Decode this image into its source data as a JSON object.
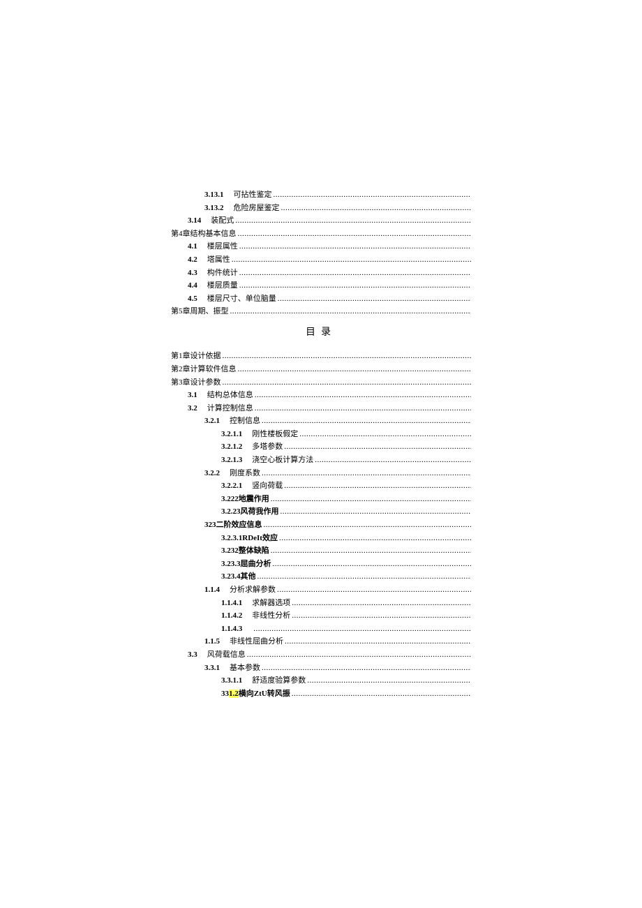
{
  "tocTitle": "目录",
  "block1": [
    {
      "indent": 2,
      "num": "3.13.1",
      "label": "可拈性鉴定"
    },
    {
      "indent": 2,
      "num": "3.13.2",
      "label": "危险房屋鉴定"
    },
    {
      "indent": 1,
      "num": "3.14",
      "label": "装配式"
    },
    {
      "indent": 0,
      "num": "",
      "label": "第4章结构基本信息",
      "plain": true
    },
    {
      "indent": 1,
      "num": "4.1",
      "label": "楼层属性"
    },
    {
      "indent": 1,
      "num": "4.2",
      "label": "塔属性"
    },
    {
      "indent": 1,
      "num": "4.3",
      "label": "构件统计"
    },
    {
      "indent": 1,
      "num": "4.4",
      "label": "楼层质量"
    },
    {
      "indent": 1,
      "num": "4.5",
      "label": "楼层尺寸、单位脑量"
    },
    {
      "indent": 0,
      "num": "",
      "label": "第5章周期、振型",
      "plain": true
    }
  ],
  "block2": [
    {
      "indent": 0,
      "num": "",
      "label": "第1章设计依据",
      "plain": true
    },
    {
      "indent": 0,
      "num": "",
      "label": "第2章计算软件信息",
      "plain": true
    },
    {
      "indent": 0,
      "num": "",
      "label": "第3章设计参数",
      "plain": true
    },
    {
      "indent": 1,
      "num": "3.1",
      "label": "结构总体信息"
    },
    {
      "indent": 1,
      "num": "3.2",
      "label": "计算控制信息"
    },
    {
      "indent": 2,
      "num": "3.2.1",
      "label": "控制信息"
    },
    {
      "indent": 3,
      "num": "3.2.1.1",
      "label": "刚性楼板假定"
    },
    {
      "indent": 3,
      "num": "3.2.1.2",
      "label": "多塔参数"
    },
    {
      "indent": 3,
      "num": "3.2.1.3",
      "label": "浇空心板计算方法"
    },
    {
      "indent": 2,
      "num": "3.2.2",
      "label": "刚度系数"
    },
    {
      "indent": 3,
      "num": "3.2.2.1",
      "label": "竖向荷载"
    },
    {
      "indent": 3,
      "num": "",
      "label": "3.222地震作用",
      "bold": true
    },
    {
      "indent": 3,
      "num": "",
      "label": "3.2.23风荷我作用",
      "bold": true
    },
    {
      "indent": 2,
      "num": "",
      "label": "323二阶效应信息",
      "bold": true
    },
    {
      "indent": 3,
      "num": "",
      "label": "3.2.3.1RDeIt效应",
      "bold": true
    },
    {
      "indent": 3,
      "num": "",
      "label": "3.232整体缺陷",
      "bold": true
    },
    {
      "indent": 3,
      "num": "",
      "label": "3.23.3屈曲分析",
      "bold": true
    },
    {
      "indent": 3,
      "num": "",
      "label": "3.23.4其他",
      "bold": true
    },
    {
      "indent": 2,
      "num": "1.1.4",
      "label": "分析求解参数"
    },
    {
      "indent": 3,
      "num": "1.1.4.1",
      "label": "求解器选项"
    },
    {
      "indent": 3,
      "num": "1.1.4.2",
      "label": "非线性分析"
    },
    {
      "indent": 3,
      "num": "1.1.4.3",
      "label": "",
      "bold": true
    },
    {
      "indent": 2,
      "num": "1.1.5",
      "label": "非线性屈曲分析"
    },
    {
      "indent": 1,
      "num": "3.3",
      "label": "风荷载信息"
    },
    {
      "indent": 2,
      "num": "3.3.1",
      "label": "基本参数"
    },
    {
      "indent": 3,
      "num": "3.3.1.1",
      "label": "舒适度验算参数"
    },
    {
      "indent": 3,
      "num": "",
      "label": "横向ZtU转风振",
      "prefix": "33",
      "highlight": "1.2",
      "bold": true
    }
  ]
}
